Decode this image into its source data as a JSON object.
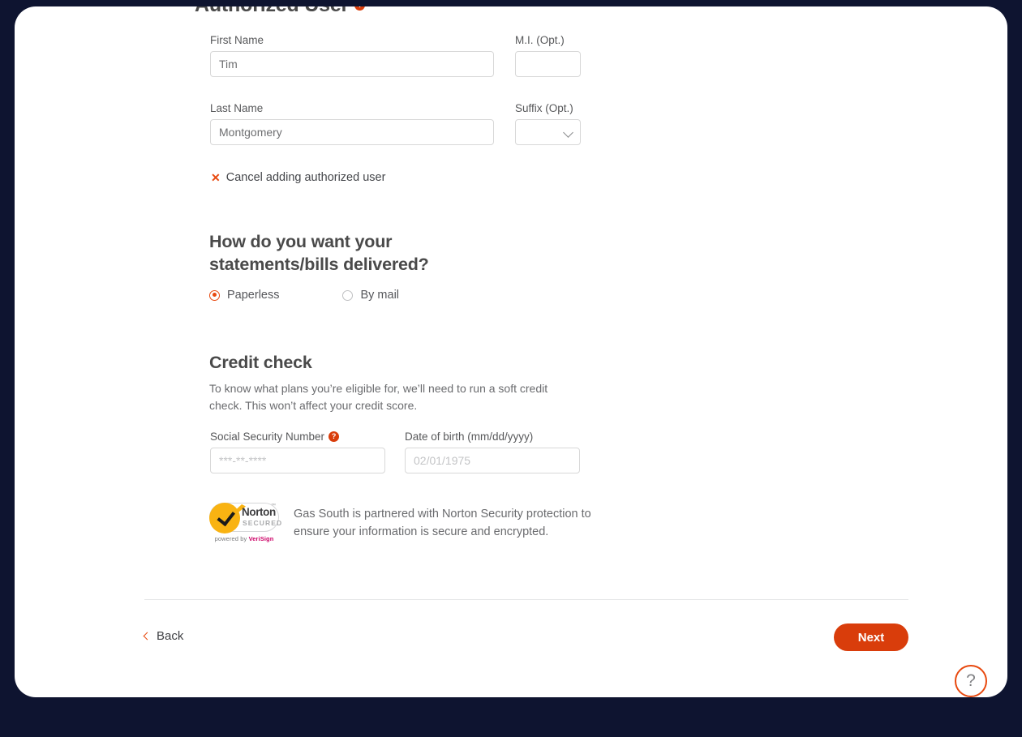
{
  "authorized_user": {
    "title": "Authorized User",
    "help_icon": "question-mark-icon",
    "help_glyph": "?",
    "first_name": {
      "label": "First Name",
      "value": "Tim"
    },
    "middle_initial": {
      "label": "M.I. (Opt.)",
      "value": ""
    },
    "last_name": {
      "label": "Last Name",
      "value": "Montgomery"
    },
    "suffix": {
      "label": "Suffix (Opt.)",
      "value": ""
    },
    "cancel_link": {
      "icon": "close-x-icon",
      "glyph": "✕",
      "label": "Cancel adding authorized user"
    }
  },
  "delivery": {
    "heading": "How do you want your statements/bills delivered?",
    "options": [
      {
        "label": "Paperless",
        "selected": true
      },
      {
        "label": "By mail",
        "selected": false
      }
    ]
  },
  "credit_check": {
    "heading": "Credit check",
    "description": "To know what plans you’re eligible for, we’ll need to run a soft credit check. This won’t affect your credit score.",
    "ssn": {
      "label": "Social Security Number",
      "help_icon": "question-mark-icon",
      "help_glyph": "?",
      "placeholder": "***-**-****",
      "value": ""
    },
    "dob": {
      "label": "Date of birth (mm/dd/yyyy)",
      "placeholder": "02/01/1975",
      "value": ""
    }
  },
  "security_badge": {
    "brand": "Norton",
    "status": "SECURED",
    "trademark": "™",
    "powered_prefix": "powered by ",
    "powered_brand": "VeriSign",
    "message": "Gas South is partnered with Norton Security protection to ensure your information is secure and encrypted."
  },
  "footer": {
    "back_label": "Back",
    "next_label": "Next"
  },
  "help_fab": {
    "icon": "question-mark-icon",
    "glyph": "?"
  },
  "colors": {
    "accent": "#d93d0b",
    "accent_light": "#e8490f",
    "heading": "#4a4a4a",
    "body_text": "#6a6b6e",
    "backdrop": "#0e1430",
    "badge_yellow": "#f9b312"
  }
}
